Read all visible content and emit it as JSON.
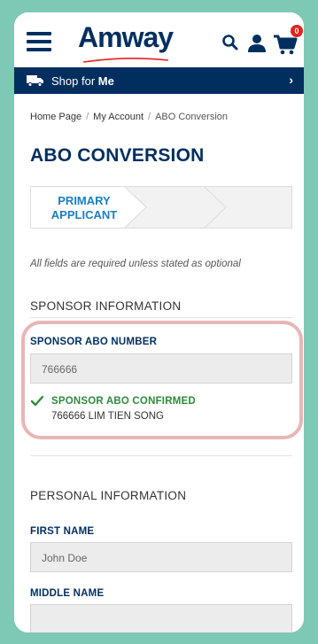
{
  "header": {
    "logo": "Amway",
    "cart_count": "0",
    "icons": [
      "hamburger-menu-icon",
      "search-icon",
      "user-icon",
      "cart-icon"
    ]
  },
  "shopbar": {
    "prefix": "Shop for",
    "target": "Me",
    "chevron": "›"
  },
  "breadcrumb": [
    "Home Page",
    "My Account",
    "ABO Conversion"
  ],
  "page_title": "ABO CONVERSION",
  "stepper": {
    "active_label_line1": "PRIMARY",
    "active_label_line2": "APPLICANT"
  },
  "required_note": "All fields are required unless stated as optional",
  "sponsor": {
    "section_title": "SPONSOR INFORMATION",
    "field_label": "SPONSOR ABO NUMBER",
    "field_value": "766666",
    "confirm_title": "SPONSOR ABO CONFIRMED",
    "confirm_name": "766666 LIM TIEN SONG"
  },
  "personal": {
    "section_title": "PERSONAL INFORMATION",
    "first_name_label": "FIRST NAME",
    "first_name_placeholder": "John Doe",
    "middle_name_label": "MIDDLE NAME",
    "middle_name_value": ""
  },
  "colors": {
    "brand": "#002f5f",
    "accent": "#1a7fc1",
    "success": "#2e8b3a",
    "badge": "#e2231a",
    "frame": "#7ec8b6",
    "highlight": "#e8b6b6"
  }
}
